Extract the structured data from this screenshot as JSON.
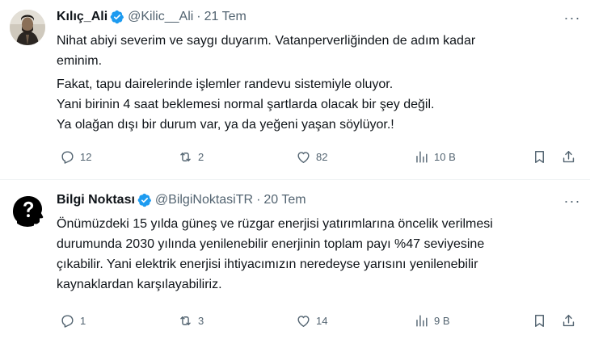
{
  "tweets": [
    {
      "display_name": "Kılıç_Ali",
      "handle": "@Kilic__Ali",
      "separator": "·",
      "time": "21 Tem",
      "avatar_icon": "portrait-photo",
      "lines": [
        "Nihat abiyi severim ve saygı duyarım. Vatanperverliğinden de adım kadar",
        "eminim.",
        "Fakat, tapu dairelerinde işlemler randevu sistemiyle oluyor.",
        "Yani birinin 4 saat beklemesi normal şartlarda olacak bir şey değil.",
        "Ya olağan dışı bir durum var, ya da yeğeni yaşan söylüyor.!"
      ],
      "stats": {
        "replies": "12",
        "retweets": "2",
        "likes": "82",
        "views": "10 B"
      }
    },
    {
      "display_name": "Bilgi Noktası",
      "handle": "@BilgiNoktasiTR",
      "separator": "·",
      "time": "20 Tem",
      "avatar_icon": "question-head-logo",
      "lines": [
        "Önümüzdeki 15 yılda güneş ve rüzgar enerjisi yatırımlarına öncelik verilmesi",
        "durumunda 2030 yılında yenilenebilir enerjinin toplam payı %47 seviyesine",
        "çıkabilir. Yani elektrik enerjisi ihtiyacımızın neredeyse yarısını yenilenebilir",
        "kaynaklardan karşılayabiliriz."
      ],
      "stats": {
        "replies": "1",
        "retweets": "3",
        "likes": "14",
        "views": "9 B"
      }
    }
  ],
  "colors": {
    "text": "#0f1419",
    "secondary": "#536471",
    "verified": "#1d9bf0",
    "divider": "#eff3f4"
  },
  "icons": {
    "verified": "verified-badge-icon",
    "more": "more-icon",
    "reply": "reply-icon",
    "retweet": "retweet-icon",
    "like": "like-icon",
    "views": "views-icon",
    "bookmark": "bookmark-icon",
    "share": "share-icon"
  }
}
